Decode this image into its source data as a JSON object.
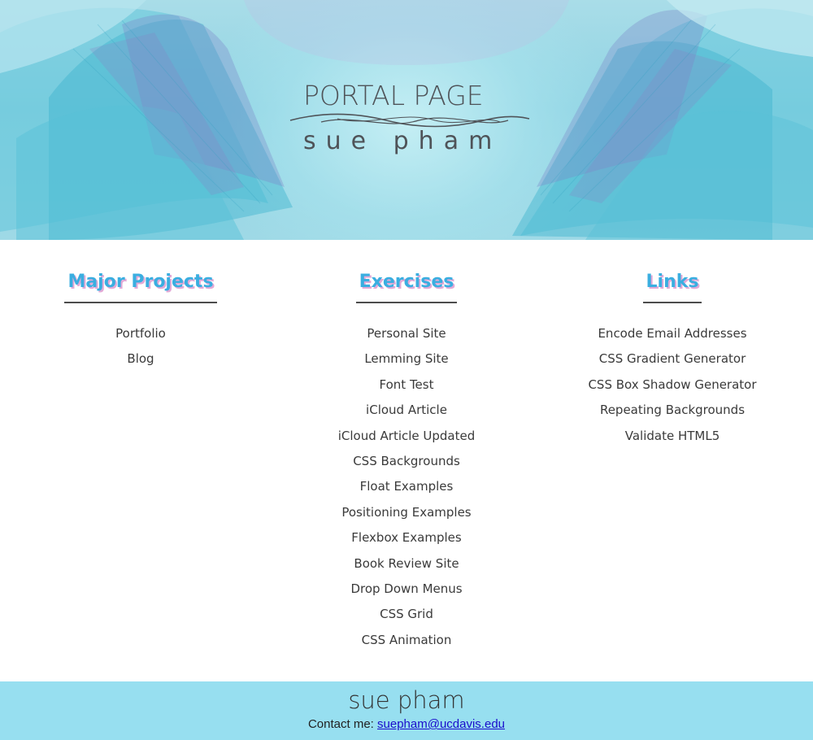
{
  "hero": {
    "logo_title": "PORTAL PAGE",
    "logo_subtitle": "sue pham"
  },
  "columns": [
    {
      "heading": "Major Projects",
      "links": [
        "Portfolio",
        "Blog"
      ]
    },
    {
      "heading": "Exercises",
      "links": [
        "Personal Site",
        "Lemming Site",
        "Font Test",
        "iCloud Article",
        "iCloud Article Updated",
        "CSS Backgrounds",
        "Float Examples",
        "Positioning Examples",
        "Flexbox Examples",
        "Book Review Site",
        "Drop Down Menus",
        "CSS Grid",
        "CSS Animation"
      ]
    },
    {
      "heading": "Links",
      "links": [
        "Encode Email Addresses",
        "CSS Gradient Generator",
        "CSS Box Shadow Generator",
        "Repeating Backgrounds",
        "Validate HTML5"
      ]
    }
  ],
  "footer": {
    "name": "sue pham",
    "contact_label": "Contact me: ",
    "email": "suepham@ucdavis.edu"
  },
  "colors": {
    "heading": "#3aaee0",
    "heading_shadow": "#e3a9d6",
    "footer_bg": "#97dff0",
    "email_link": "#1a0dcc"
  }
}
